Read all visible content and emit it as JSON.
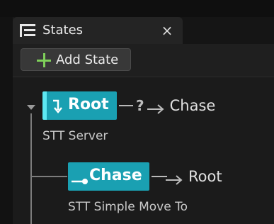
{
  "tab": {
    "title": "States",
    "close_glyph": "×",
    "icon": "tree-list-icon"
  },
  "toolbar": {
    "add_state_label": "Add State",
    "add_icon": "plus-icon"
  },
  "tree": {
    "root": {
      "name": "Root",
      "icon": "transition-arrow-icon",
      "transition_condition": "?",
      "transition_target": "Chase",
      "task": "STT Server",
      "expanded": true
    },
    "children": [
      {
        "name": "Chase",
        "icon": "leaf-state-icon",
        "transition_target": "Root",
        "task": "STT Simple Move To"
      }
    ]
  },
  "colors": {
    "node_fill": "#1aa0b2",
    "root_accent": "#5de8f2",
    "add_plus": "#7fd05a",
    "background": "#1b1b1b"
  }
}
